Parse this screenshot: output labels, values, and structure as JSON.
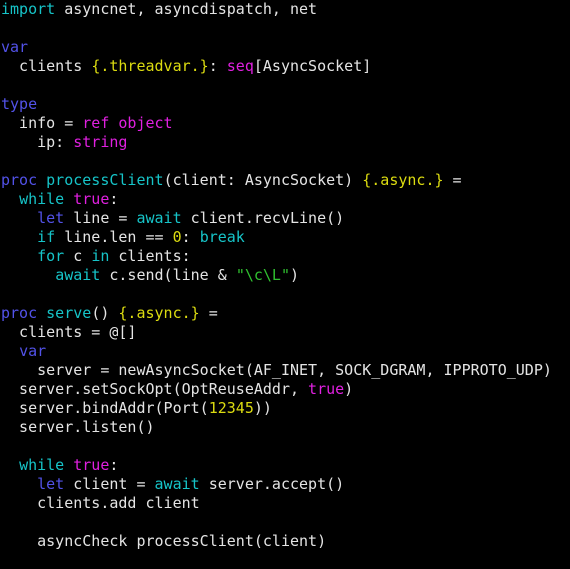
{
  "colors": {
    "background": "#000000",
    "text": "#e4e4e4",
    "keyword": "#5252e8",
    "builtin": "#16c4c8",
    "type": "#e020e0",
    "pragma": "#dcdc10",
    "string": "#30c030"
  },
  "code_lines": [
    [
      [
        "import",
        "cy"
      ],
      [
        " asyncnet, asyncdispatch, net",
        "tx"
      ]
    ],
    [],
    [
      [
        "var",
        "kw"
      ]
    ],
    [
      [
        "  clients ",
        "tx"
      ],
      [
        "{.threadvar.}",
        "yl"
      ],
      [
        ": ",
        "tx"
      ],
      [
        "seq",
        "mg"
      ],
      [
        "[AsyncSocket]",
        "tx"
      ]
    ],
    [],
    [
      [
        "type",
        "kw"
      ]
    ],
    [
      [
        "  info = ",
        "tx"
      ],
      [
        "ref",
        "mg"
      ],
      [
        " ",
        "tx"
      ],
      [
        "object",
        "mg"
      ]
    ],
    [
      [
        "    ip: ",
        "tx"
      ],
      [
        "string",
        "mg"
      ]
    ],
    [],
    [
      [
        "proc",
        "kw"
      ],
      [
        " ",
        "tx"
      ],
      [
        "processClient",
        "cy"
      ],
      [
        "(client: AsyncSocket) ",
        "tx"
      ],
      [
        "{.async.}",
        "yl"
      ],
      [
        " =",
        "tx"
      ]
    ],
    [
      [
        "  ",
        "tx"
      ],
      [
        "while",
        "cy"
      ],
      [
        " ",
        "tx"
      ],
      [
        "true",
        "mg"
      ],
      [
        ":",
        "tx"
      ]
    ],
    [
      [
        "    ",
        "tx"
      ],
      [
        "let",
        "kw"
      ],
      [
        " line = ",
        "tx"
      ],
      [
        "await",
        "cy"
      ],
      [
        " client.recvLine()",
        "tx"
      ]
    ],
    [
      [
        "    ",
        "tx"
      ],
      [
        "if",
        "cy"
      ],
      [
        " line.len == ",
        "tx"
      ],
      [
        "0",
        "yl"
      ],
      [
        ": ",
        "tx"
      ],
      [
        "break",
        "cy"
      ]
    ],
    [
      [
        "    ",
        "tx"
      ],
      [
        "for",
        "cy"
      ],
      [
        " c ",
        "tx"
      ],
      [
        "in",
        "cy"
      ],
      [
        " clients:",
        "tx"
      ]
    ],
    [
      [
        "      ",
        "tx"
      ],
      [
        "await",
        "cy"
      ],
      [
        " c.send(line & ",
        "tx"
      ],
      [
        "\"\\c\\L\"",
        "gr"
      ],
      [
        ")",
        "tx"
      ]
    ],
    [],
    [
      [
        "proc",
        "kw"
      ],
      [
        " ",
        "tx"
      ],
      [
        "serve",
        "cy"
      ],
      [
        "() ",
        "tx"
      ],
      [
        "{.async.}",
        "yl"
      ],
      [
        " =",
        "tx"
      ]
    ],
    [
      [
        "  clients = @[]",
        "tx"
      ]
    ],
    [
      [
        "  ",
        "tx"
      ],
      [
        "var",
        "kw"
      ]
    ],
    [
      [
        "    server = newAsyncSocket(AF_INET, SOCK_DGRAM, IPPROTO_UDP)",
        "tx"
      ]
    ],
    [
      [
        "  server.setSockOpt(OptReuseAddr, ",
        "tx"
      ],
      [
        "true",
        "mg"
      ],
      [
        ")",
        "tx"
      ]
    ],
    [
      [
        "  server.bindAddr(Port(",
        "tx"
      ],
      [
        "12345",
        "yl"
      ],
      [
        "))",
        "tx"
      ]
    ],
    [
      [
        "  server.listen()",
        "tx"
      ]
    ],
    [],
    [
      [
        "  ",
        "tx"
      ],
      [
        "while",
        "cy"
      ],
      [
        " ",
        "tx"
      ],
      [
        "true",
        "mg"
      ],
      [
        ":",
        "tx"
      ]
    ],
    [
      [
        "    ",
        "tx"
      ],
      [
        "let",
        "kw"
      ],
      [
        " client = ",
        "tx"
      ],
      [
        "await",
        "cy"
      ],
      [
        " server.accept()",
        "tx"
      ]
    ],
    [
      [
        "    clients.add client",
        "tx"
      ]
    ],
    [],
    [
      [
        "    asyncCheck processClient(client)",
        "tx"
      ]
    ]
  ]
}
